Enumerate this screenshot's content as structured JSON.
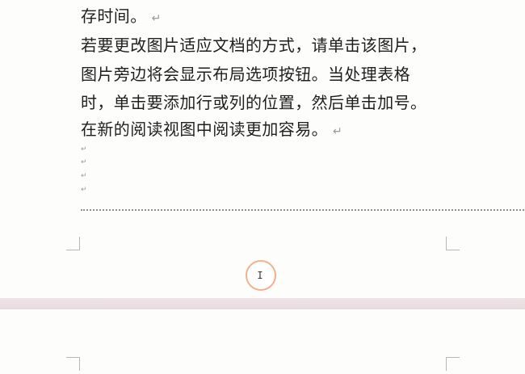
{
  "document": {
    "lines": [
      "存时间。",
      "若要更改图片适应文档的方式，请单击该图片，",
      "图片旁边将会显示布局选项按钮。当处理表格",
      "时，单击要添加行或列的位置，然后单击加号。",
      "在新的阅读视图中阅读更加容易。"
    ],
    "paragraph_mark": "↵",
    "empty_paragraph_mark": "↵",
    "cursor_glyph": "I"
  },
  "icons": {
    "paragraph_mark": "return-arrow-icon",
    "cursor": "text-cursor-icon"
  },
  "colors": {
    "page_background": "#fdfdfc",
    "gap_background": "#e6dcdf",
    "text": "#1f1f1f",
    "formatting_mark": "#9b9b9b",
    "cursor_ring": "#f2b08b"
  }
}
